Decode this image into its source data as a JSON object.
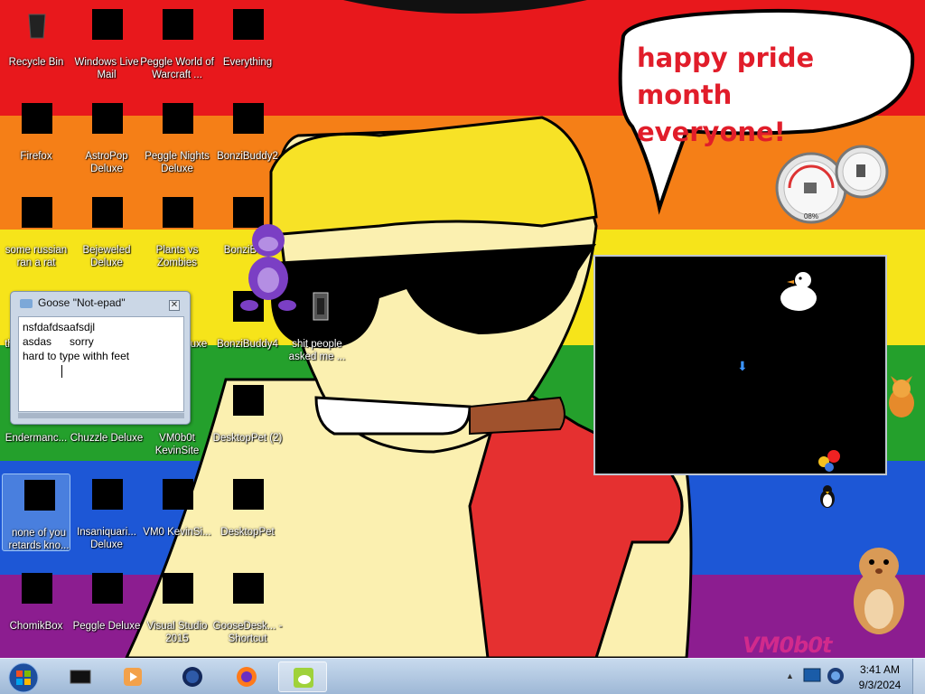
{
  "wallpaper": {
    "bubble_text_line1": "happy pride month",
    "bubble_text_line2": "everyone!",
    "watermark": "VM0b0t",
    "gauge_readout": "08%",
    "colors": {
      "red": "#e8181c",
      "orange": "#f57f17",
      "yellow": "#f6e41a",
      "green": "#24a02c",
      "blue": "#1d57d6",
      "purple": "#8c1d90"
    }
  },
  "icons": [
    {
      "label": "Recycle Bin",
      "icon": "recycle-bin-icon"
    },
    {
      "label": "Windows Live Mail",
      "icon": "mail-icon"
    },
    {
      "label": "Peggle World of Warcraft ...",
      "icon": "peggle-icon"
    },
    {
      "label": "Everything",
      "icon": "search-app-icon"
    },
    {
      "label": "Firefox",
      "icon": "firefox-icon"
    },
    {
      "label": "AstroPop Deluxe",
      "icon": "astropop-icon"
    },
    {
      "label": "Peggle Nights Deluxe",
      "icon": "peggle-nights-icon"
    },
    {
      "label": "BonziBuddy2",
      "icon": "folder-icon"
    },
    {
      "label": "some russian ran a rat",
      "icon": "app-icon"
    },
    {
      "label": "Bejeweled Deluxe",
      "icon": "bejeweled-icon"
    },
    {
      "label": "Plants vs Zombies",
      "icon": "pvz-icon"
    },
    {
      "label": "BonziBu...",
      "icon": "bonzi-icon"
    },
    {
      "label": "th",
      "icon": "app-icon"
    },
    {
      "label": "uxe",
      "icon": "app-icon"
    },
    {
      "label": "BonziBuddy4",
      "icon": "bonzi-icon"
    },
    {
      "label": "shit people asked me ...",
      "icon": "folder-icon"
    },
    {
      "label": "Endermanc...",
      "icon": "app-icon"
    },
    {
      "label": "Chuzzle Deluxe",
      "icon": "chuzzle-icon"
    },
    {
      "label": "VM0b0t KevinSite",
      "icon": "app-icon"
    },
    {
      "label": "DesktopPet (2)",
      "icon": "desktoppet-icon"
    },
    {
      "label": "none of you retards kno...",
      "icon": "app-icon"
    },
    {
      "label": "Insaniquari... Deluxe",
      "icon": "insaniquarium-icon"
    },
    {
      "label": "VM0 KevinSi...",
      "icon": "app-icon"
    },
    {
      "label": "DesktopPet",
      "icon": "desktoppet-icon"
    },
    {
      "label": "ChomikBox",
      "icon": "chomikbox-icon"
    },
    {
      "label": "Peggle Deluxe",
      "icon": "peggle-icon"
    },
    {
      "label": "Visual Studio 2015",
      "icon": "visual-studio-icon"
    },
    {
      "label": "GooseDesk... - Shortcut",
      "icon": "goose-icon"
    }
  ],
  "notepad": {
    "title": "Goose \"Not-epad\"",
    "line1": "nsfdafdsaafsdjl",
    "line2": "asdas      sorry",
    "line3": "hard to type withh feet"
  },
  "taskbar": {
    "items": [
      {
        "name": "taskbar-app-monitor",
        "icon": "monitor-icon"
      },
      {
        "name": "taskbar-app-player",
        "icon": "media-player-icon"
      },
      {
        "name": "taskbar-app-globe",
        "icon": "globe-icon"
      },
      {
        "name": "taskbar-app-firefox",
        "icon": "firefox-icon"
      },
      {
        "name": "taskbar-app-goose",
        "icon": "goose-icon"
      }
    ],
    "clock_time": "3:41 AM",
    "clock_date": "9/3/2024"
  }
}
